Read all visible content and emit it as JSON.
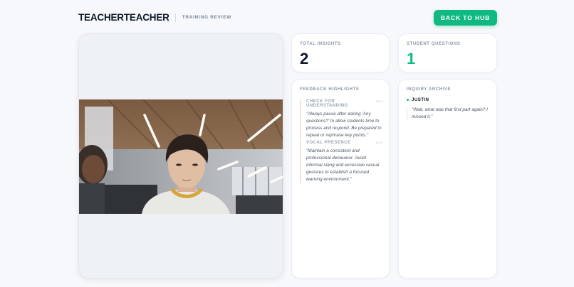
{
  "header": {
    "brand": "TEACHERTEACHER",
    "subtitle": "TRAINING REVIEW",
    "back_button": "BACK TO HUB"
  },
  "stats": {
    "insights_label": "TOTAL INSIGHTS",
    "insights_value": "2",
    "questions_label": "STUDENT QUESTIONS",
    "questions_value": "1"
  },
  "feedback": {
    "label": "FEEDBACK HIGHLIGHTS",
    "items": [
      {
        "title": "CHECK FOR UNDERSTANDING",
        "time": "00:14",
        "text": "\"Always pause after asking 'Any questions?' to allow students time to process and respond. Be prepared to repeat or rephrase key points.\""
      },
      {
        "title": "VOCAL PRESENCE",
        "time": "00:21",
        "text": "\"Maintain a consistent and professional demeanor. Avoid informal slang and excessive casual gestures to establish a focused learning environment.\""
      }
    ]
  },
  "inquiry": {
    "label": "INQUIRY ARCHIVE",
    "items": [
      {
        "name": "JUSTIN",
        "text": "\"Wait, what was that first part again? I missed it.\""
      }
    ]
  },
  "colors": {
    "accent": "#10b981",
    "feedback_border": "#f3c4c4",
    "background": "#f6f8fb"
  },
  "icons": {
    "status_dot": "green-dot-icon"
  }
}
